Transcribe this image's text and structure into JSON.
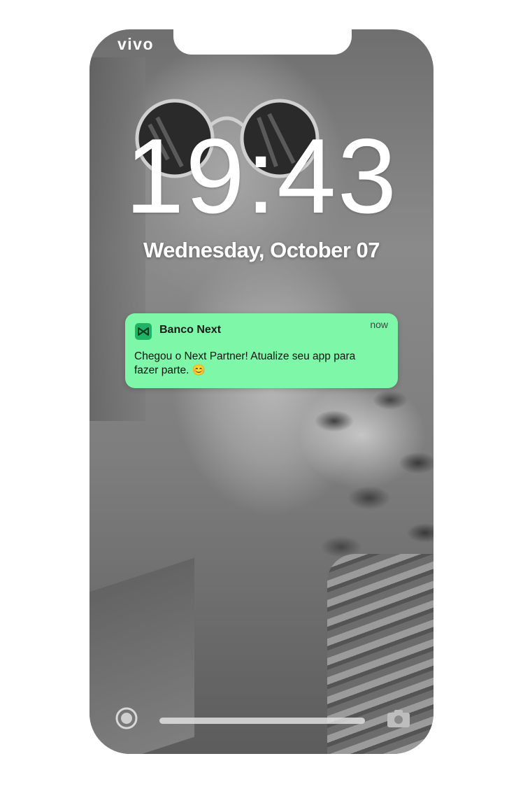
{
  "status_bar": {
    "carrier": "vivo"
  },
  "lock_screen": {
    "time": "19:43",
    "date": "Wednesday, October 07"
  },
  "notification": {
    "app_name": "Banco Next",
    "time": "now",
    "message": "Chegou o Next Partner! Atualize seu app para fazer parte. 😊",
    "background_color": "#7ef7a8",
    "icon": "banco-next-logo-icon"
  },
  "quick_actions": {
    "left_icon": "flashlight-icon",
    "right_icon": "camera-icon"
  },
  "colors": {
    "time_text": "#ffffff",
    "app_icon": "#1fb465"
  }
}
